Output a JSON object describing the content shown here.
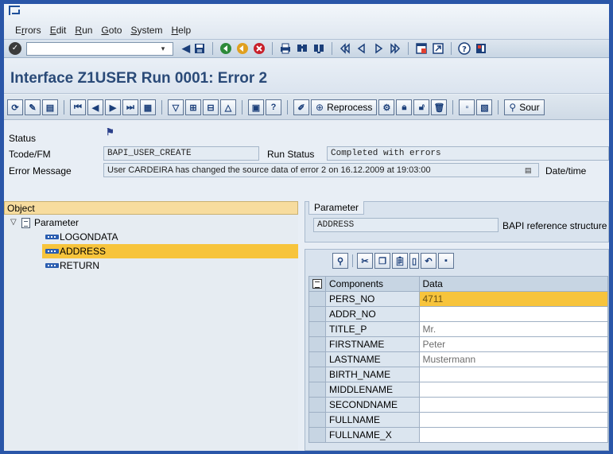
{
  "menu": {
    "items": [
      {
        "before": "E",
        "u": "r",
        "after": "rors"
      },
      {
        "before": "",
        "u": "E",
        "after": "dit"
      },
      {
        "before": "",
        "u": "R",
        "after": "un"
      },
      {
        "before": "",
        "u": "G",
        "after": "oto"
      },
      {
        "before": "",
        "u": "S",
        "after": "ystem"
      },
      {
        "before": "",
        "u": "H",
        "after": "elp"
      }
    ]
  },
  "toolbar": {
    "command_value": ""
  },
  "title": "Interface Z1USER Run 0001: Error 2",
  "apptoolbar": {
    "reprocess_label": "Reprocess",
    "source_label": "Sour"
  },
  "header": {
    "status_label": "Status",
    "tcode_label": "Tcode/FM",
    "tcode_value": "BAPI_USER_CREATE",
    "run_status_label": "Run Status",
    "run_status_value": "Completed with errors",
    "error_label": "Error Message",
    "error_value": "User CARDEIRA has changed the source data of error 2 on 16.12.2009 at 19:03:00",
    "datetime_label": "Date/time"
  },
  "tree": {
    "header": "Object",
    "root": "Parameter",
    "children": [
      "LOGONDATA",
      "ADDRESS",
      "RETURN"
    ],
    "selected": "ADDRESS"
  },
  "param": {
    "tab": "Parameter",
    "name": "ADDRESS",
    "description": "BAPI reference structure"
  },
  "grid": {
    "col_components": "Components",
    "col_data": "Data",
    "rows": [
      {
        "component": "PERS_NO",
        "data": "4711"
      },
      {
        "component": "ADDR_NO",
        "data": ""
      },
      {
        "component": "TITLE_P",
        "data": "Mr."
      },
      {
        "component": "FIRSTNAME",
        "data": "Peter"
      },
      {
        "component": "LASTNAME",
        "data": "Mustermann"
      },
      {
        "component": "BIRTH_NAME",
        "data": ""
      },
      {
        "component": "MIDDLENAME",
        "data": ""
      },
      {
        "component": "SECONDNAME",
        "data": ""
      },
      {
        "component": "FULLNAME",
        "data": ""
      },
      {
        "component": "FULLNAME_X",
        "data": ""
      }
    ]
  },
  "colors": {
    "selection": "#f7c43c",
    "frame": "#2a56a8",
    "tree_header": "#f7dc9e"
  }
}
